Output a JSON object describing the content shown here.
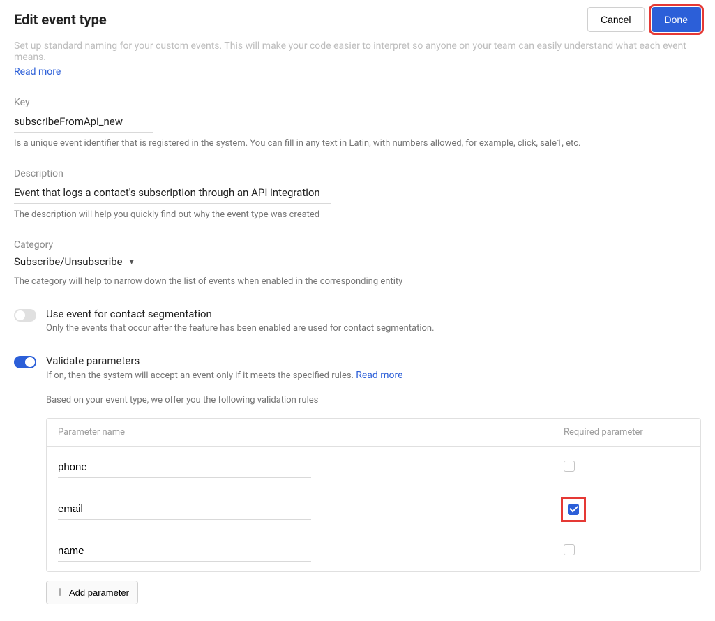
{
  "header": {
    "title": "Edit event type",
    "cancel": "Cancel",
    "done": "Done"
  },
  "intro": {
    "cut_text": "Set up standard naming for your custom events. This will make your code easier to interpret so anyone on your team can easily understand what each event means.",
    "read_more": "Read more"
  },
  "key": {
    "label": "Key",
    "value": "subscribeFromApi_new",
    "helper": "Is a unique event identifier that is registered in the system. You can fill in any text in Latin, with numbers allowed, for example, click, sale1, etc."
  },
  "description": {
    "label": "Description",
    "value": "Event that logs a contact's subscription through an API integration",
    "helper": "The description will help you quickly find out why the event type was created"
  },
  "category": {
    "label": "Category",
    "value": "Subscribe/Unsubscribe",
    "helper": "The category will help to narrow down the list of events when enabled in the corresponding entity"
  },
  "segmentation": {
    "title": "Use event for contact segmentation",
    "sub": "Only the events that occur after the feature has been enabled are used for contact segmentation."
  },
  "validate": {
    "title": "Validate parameters",
    "sub_prefix": "If on, then the system will accept an event only if it meets the specified rules.  ",
    "read_more": "Read more",
    "hint": "Based on your event type, we offer you the following validation rules"
  },
  "params": {
    "header_name": "Parameter name",
    "header_required": "Required parameter",
    "rows": [
      {
        "name": "phone",
        "required": false,
        "highlight": false
      },
      {
        "name": "email",
        "required": true,
        "highlight": true
      },
      {
        "name": "name",
        "required": false,
        "highlight": false
      }
    ],
    "add_label": "Add parameter"
  }
}
